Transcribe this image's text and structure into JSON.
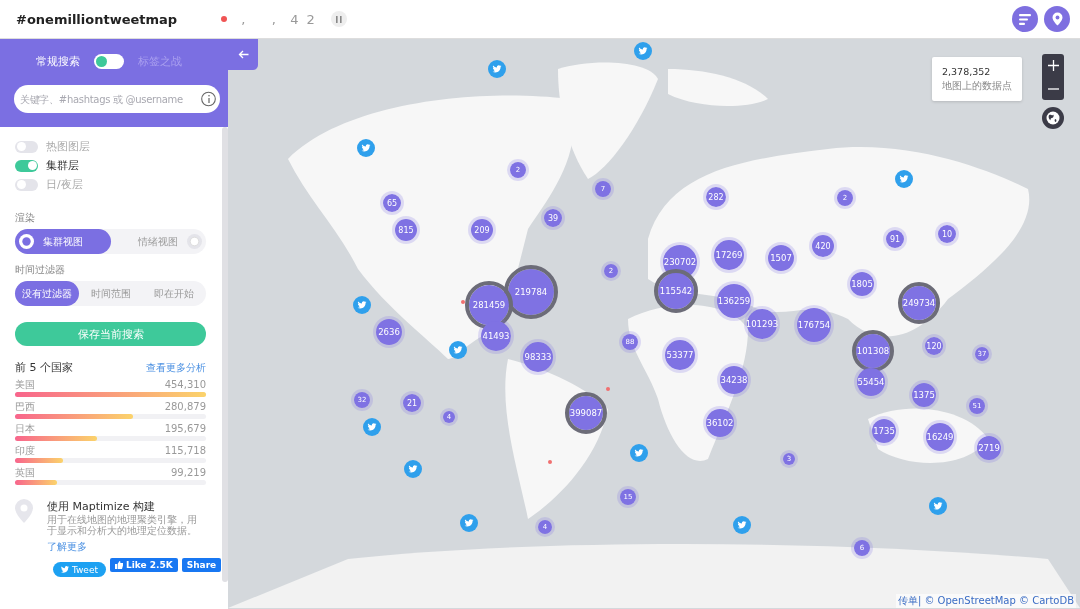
{
  "header": {
    "title": "#onemilliontweetmap",
    "live_counter": ",    ,  4 2"
  },
  "search_mode": {
    "options": [
      {
        "label": "常规搜索",
        "selected": true
      },
      {
        "label": "标签之战",
        "selected": false
      }
    ]
  },
  "search": {
    "placeholder": "关键字、#hashtags 或 @username"
  },
  "layers": [
    {
      "label": "热图图层",
      "on": false
    },
    {
      "label": "集群层",
      "on": true
    },
    {
      "label": "日/夜层",
      "on": false
    }
  ],
  "render": {
    "label": "渲染",
    "options": [
      {
        "label": "集群视图",
        "selected": true
      },
      {
        "label": "情绪视图",
        "selected": false
      }
    ]
  },
  "time_filter": {
    "label": "时间过滤器",
    "options": [
      {
        "label": "没有过滤器",
        "selected": true
      },
      {
        "label": "时间范围",
        "selected": false
      },
      {
        "label": "即在开始",
        "selected": false
      }
    ]
  },
  "save_button": "保存当前搜索",
  "top_countries": {
    "title": "前 5 个国家",
    "link": "查看更多分析",
    "rows": [
      {
        "name": "美国",
        "value": "454,310",
        "level": 1.0
      },
      {
        "name": "巴西",
        "value": "280,879",
        "level": 0.62
      },
      {
        "name": "日本",
        "value": "195,679",
        "level": 0.43
      },
      {
        "name": "印度",
        "value": "115,718",
        "level": 0.25
      },
      {
        "name": "英国",
        "value": "99,219",
        "level": 0.22
      }
    ]
  },
  "promo": {
    "title": "使用 Maptimize 构建",
    "description": "用于在线地图的地理聚类引擎，用于显示和分析大的地理定位数据。",
    "link": "了解更多"
  },
  "social": {
    "tweet": "Tweet",
    "like": "Like 2.5K",
    "share": "Share"
  },
  "map": {
    "stats_count": "2,378,352",
    "stats_label": "地图上的数据点",
    "attribution": "传单| © OpenStreetMap © CartoDB",
    "clusters": [
      {
        "label": "2",
        "highlighted": false
      },
      {
        "label": "7",
        "highlighted": false
      },
      {
        "label": "65",
        "highlighted": false
      },
      {
        "label": "39",
        "highlighted": false
      },
      {
        "label": "815",
        "highlighted": false
      },
      {
        "label": "209",
        "highlighted": false
      },
      {
        "label": "282",
        "highlighted": false
      },
      {
        "label": "2",
        "highlighted": false
      },
      {
        "label": "10",
        "highlighted": false
      },
      {
        "label": "91",
        "highlighted": false
      },
      {
        "label": "420",
        "highlighted": false
      },
      {
        "label": "17269",
        "highlighted": false
      },
      {
        "label": "1507",
        "highlighted": false
      },
      {
        "label": "230702",
        "highlighted": false
      },
      {
        "label": "2",
        "highlighted": false
      },
      {
        "label": "219784",
        "highlighted": true
      },
      {
        "label": "281459",
        "highlighted": true
      },
      {
        "label": "115542",
        "highlighted": true
      },
      {
        "label": "136259",
        "highlighted": false
      },
      {
        "label": "249734",
        "highlighted": true
      },
      {
        "label": "1805",
        "highlighted": false
      },
      {
        "label": "2636",
        "highlighted": false
      },
      {
        "label": "41493",
        "highlighted": false
      },
      {
        "label": "101293",
        "highlighted": false
      },
      {
        "label": "176754",
        "highlighted": false
      },
      {
        "label": "101308",
        "highlighted": true
      },
      {
        "label": "88",
        "highlighted": false
      },
      {
        "label": "120",
        "highlighted": false
      },
      {
        "label": "37",
        "highlighted": false
      },
      {
        "label": "98333",
        "highlighted": false
      },
      {
        "label": "53377",
        "highlighted": false
      },
      {
        "label": "55454",
        "highlighted": false
      },
      {
        "label": "34238",
        "highlighted": false
      },
      {
        "label": "1375",
        "highlighted": false
      },
      {
        "label": "32",
        "highlighted": false
      },
      {
        "label": "21",
        "highlighted": false
      },
      {
        "label": "4",
        "highlighted": false
      },
      {
        "label": "399087",
        "highlighted": true
      },
      {
        "label": "51",
        "highlighted": false
      },
      {
        "label": "36102",
        "highlighted": false
      },
      {
        "label": "1735",
        "highlighted": false
      },
      {
        "label": "16249",
        "highlighted": false
      },
      {
        "label": "2719",
        "highlighted": false
      },
      {
        "label": "3",
        "highlighted": false
      },
      {
        "label": "15",
        "highlighted": false
      },
      {
        "label": "4",
        "highlighted": false
      },
      {
        "label": "6",
        "highlighted": false
      }
    ]
  }
}
